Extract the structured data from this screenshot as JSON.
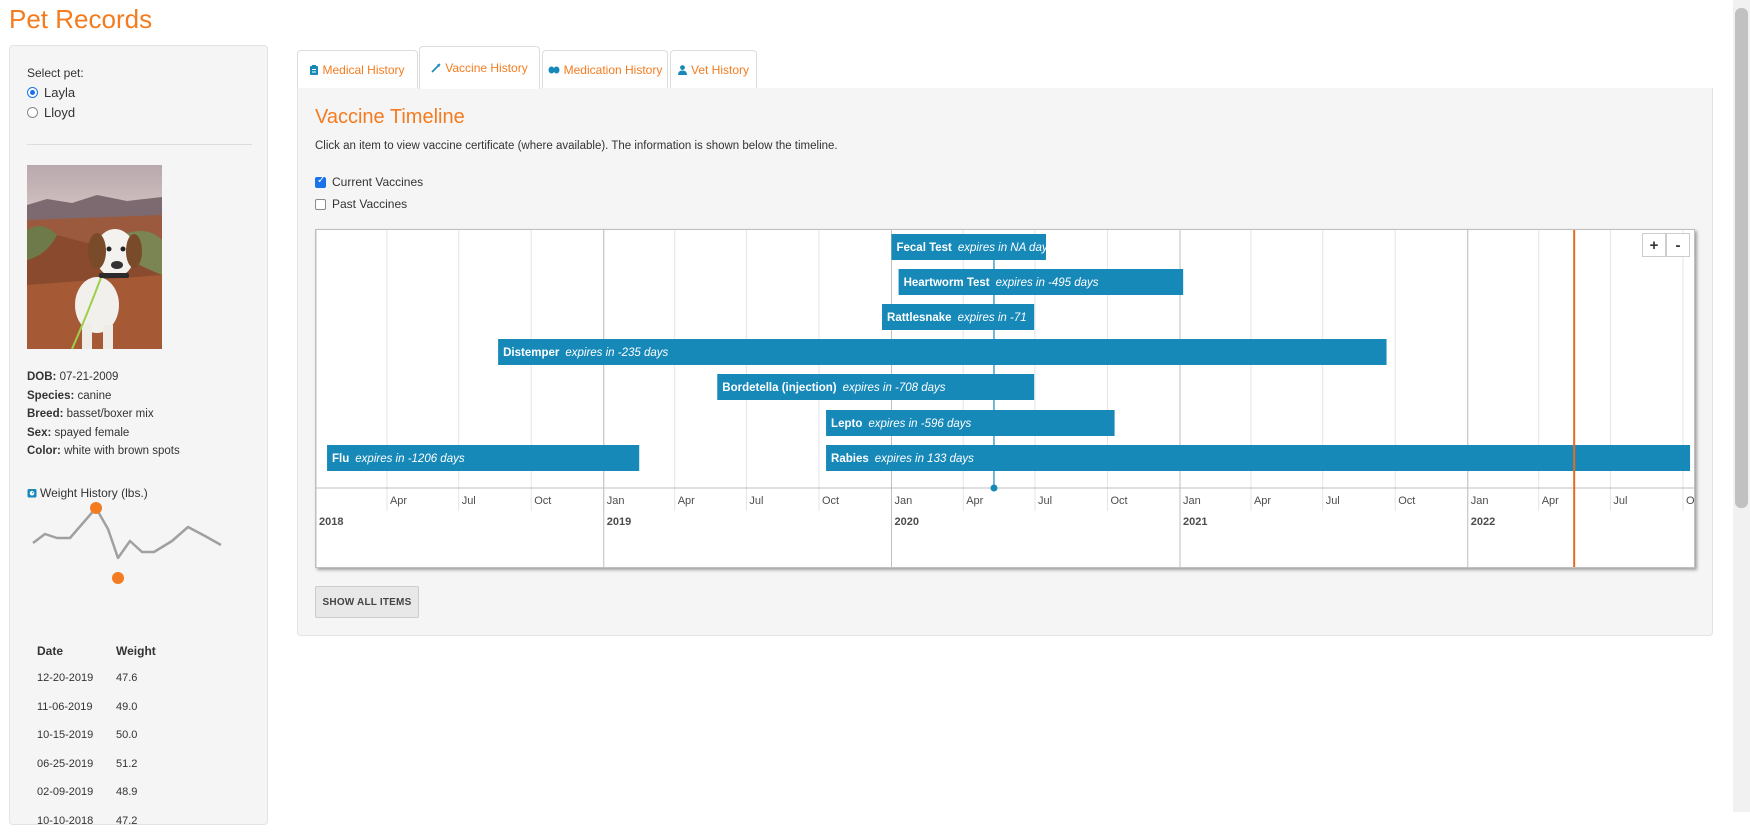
{
  "app": {
    "title": "Pet Records"
  },
  "sidebar": {
    "select_label": "Select pet:",
    "pets": [
      {
        "name": "Layla",
        "selected": true
      },
      {
        "name": "Lloyd",
        "selected": false
      }
    ],
    "info": [
      {
        "label": "DOB:",
        "value": "07-21-2009"
      },
      {
        "label": "Species:",
        "value": "canine"
      },
      {
        "label": "Breed:",
        "value": "basset/boxer mix"
      },
      {
        "label": "Sex:",
        "value": "spayed female"
      },
      {
        "label": "Color:",
        "value": "white with brown spots"
      }
    ],
    "weight_title": "Weight History (lbs.)",
    "weight_columns": [
      "Date",
      "Weight"
    ],
    "weight_rows": [
      [
        "12-20-2019",
        "47.6"
      ],
      [
        "11-06-2019",
        "49.0"
      ],
      [
        "10-15-2019",
        "50.0"
      ],
      [
        "06-25-2019",
        "51.2"
      ],
      [
        "02-09-2019",
        "48.9"
      ],
      [
        "10-10-2018",
        "47.2"
      ]
    ]
  },
  "tabs": [
    {
      "label": "Medical History",
      "icon": "clipboard-icon",
      "active": false
    },
    {
      "label": "Vaccine History",
      "icon": "syringe-icon",
      "active": true
    },
    {
      "label": "Medication History",
      "icon": "pills-icon",
      "active": false
    },
    {
      "label": "Vet History",
      "icon": "user-md-icon",
      "active": false
    }
  ],
  "panel": {
    "title": "Vaccine Timeline",
    "description": "Click an item to view vaccine certificate (where available). The information is shown below the timeline.",
    "filters": [
      {
        "label": "Current Vaccines",
        "checked": true
      },
      {
        "label": "Past Vaccines",
        "checked": false
      }
    ],
    "zoom_in": "+",
    "zoom_out": "-",
    "show_all_label": "SHOW ALL ITEMS"
  },
  "colors": {
    "accent": "#f47c20",
    "item_bar": "#1789b9",
    "current_time": "#e8691f"
  },
  "timeline": {
    "axis_start": "2018-01-01",
    "axis_end": "2022-10-15",
    "current_date": "2022-05-16",
    "selected_marker_date": "2020-05-10",
    "month_ticks": [
      {
        "date": "2018-04-01",
        "label": "Apr"
      },
      {
        "date": "2018-07-01",
        "label": "Jul"
      },
      {
        "date": "2018-10-01",
        "label": "Oct"
      },
      {
        "date": "2019-01-01",
        "label": "Jan"
      },
      {
        "date": "2019-04-01",
        "label": "Apr"
      },
      {
        "date": "2019-07-01",
        "label": "Jul"
      },
      {
        "date": "2019-10-01",
        "label": "Oct"
      },
      {
        "date": "2020-01-01",
        "label": "Jan"
      },
      {
        "date": "2020-04-01",
        "label": "Apr"
      },
      {
        "date": "2020-07-01",
        "label": "Jul"
      },
      {
        "date": "2020-10-01",
        "label": "Oct"
      },
      {
        "date": "2021-01-01",
        "label": "Jan"
      },
      {
        "date": "2021-04-01",
        "label": "Apr"
      },
      {
        "date": "2021-07-01",
        "label": "Jul"
      },
      {
        "date": "2021-10-01",
        "label": "Oct"
      },
      {
        "date": "2022-01-01",
        "label": "Jan"
      },
      {
        "date": "2022-04-01",
        "label": "Apr"
      },
      {
        "date": "2022-07-01",
        "label": "Jul"
      },
      {
        "date": "2022-10-01",
        "label": "Oc"
      }
    ],
    "year_ticks": [
      {
        "date": "2018-01-01",
        "label": "2018"
      },
      {
        "date": "2019-01-01",
        "label": "2019"
      },
      {
        "date": "2020-01-01",
        "label": "2020"
      },
      {
        "date": "2021-01-01",
        "label": "2021"
      },
      {
        "date": "2022-01-01",
        "label": "2022"
      }
    ],
    "items": [
      {
        "name": "Fecal Test",
        "note": "expires in NA days",
        "start": "2020-01-01",
        "end": "2020-07-15"
      },
      {
        "name": "Heartworm Test",
        "note": "expires in -495 days",
        "start": "2020-01-10",
        "end": "2021-01-05"
      },
      {
        "name": "Rattlesnake",
        "note": "expires in -71",
        "start": "2019-12-20",
        "end": "2020-06-30"
      },
      {
        "name": "Distemper",
        "note": "expires in -235 days",
        "start": "2018-08-20",
        "end": "2021-09-20"
      },
      {
        "name": "Bordetella (injection)",
        "note": "expires in -708 days",
        "start": "2019-05-25",
        "end": "2020-06-30"
      },
      {
        "name": "Lepto",
        "note": "expires in -596 days",
        "start": "2019-10-10",
        "end": "2020-10-10"
      },
      {
        "name": "Flu",
        "note": "expires in -1206 days",
        "start": "2018-01-15",
        "end": "2019-02-15"
      },
      {
        "name": "Rabies",
        "note": "expires in 133 days",
        "start": "2019-10-10",
        "end": "2022-10-10"
      }
    ]
  }
}
